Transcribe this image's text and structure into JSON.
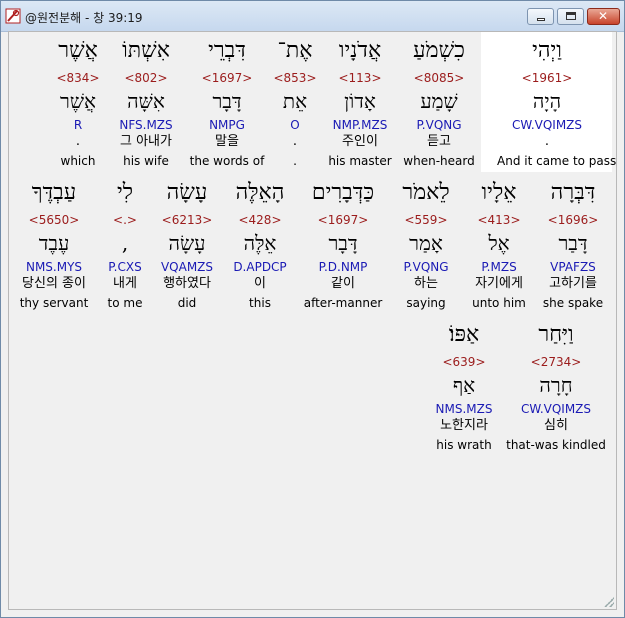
{
  "window": {
    "title": "@원전분해 - 창 39:19"
  },
  "rows": [
    [
      {
        "hebrew": "וַיְהִי",
        "strong": "<1961>",
        "lemma": "הָיָה",
        "morph": "CW.VQIMZS",
        "korean": ".",
        "english": "And it came to pass"
      },
      {
        "hebrew": "כִשְׁמֹעַ",
        "strong": "<8085>",
        "lemma": "שָׁמַע",
        "morph": "P.VQNG",
        "korean": "듣고",
        "english": "when-heard"
      },
      {
        "hebrew": "אֲדֹנָיו",
        "strong": "<113>",
        "lemma": "אָדוֹן",
        "morph": "NMP.MZS",
        "korean": "주인이",
        "english": "his master"
      },
      {
        "hebrew": "אֶת־",
        "strong": "<853>",
        "lemma": "אֵת",
        "morph": "O",
        "korean": ".",
        "english": "."
      },
      {
        "hebrew": "דִּבְרֵי",
        "strong": "<1697>",
        "lemma": "דָּבָר",
        "morph": "NMPG",
        "korean": "말을",
        "english": "the words of"
      },
      {
        "hebrew": "אִשְׁתּוֹ",
        "strong": "<802>",
        "lemma": "אִשָּׁה",
        "morph": "NFS.MZS",
        "korean": "그 아내가",
        "english": "his wife"
      },
      {
        "hebrew": "אֲשֶׁר",
        "strong": "<834>",
        "lemma": "אֲשֶׁר",
        "morph": "R",
        "korean": ".",
        "english": "which"
      }
    ],
    [
      {
        "hebrew": "דִּבְּרָה",
        "strong": "<1696>",
        "lemma": "דָּבַר",
        "morph": "VPAFZS",
        "korean": "고하기를",
        "english": "she spake"
      },
      {
        "hebrew": "אֵלָיו",
        "strong": "<413>",
        "lemma": "אֶל",
        "morph": "P.MZS",
        "korean": "자기에게",
        "english": "unto him"
      },
      {
        "hebrew": "לֵאמֹר",
        "strong": "<559>",
        "lemma": "אָמַר",
        "morph": "P.VQNG",
        "korean": "하는",
        "english": "saying"
      },
      {
        "hebrew": "כַּדְּבָרִים",
        "strong": "<1697>",
        "lemma": "דָּבָר",
        "morph": "P.D.NMP",
        "korean": "같이",
        "english": "after-manner"
      },
      {
        "hebrew": "הָאֵלֶּה",
        "strong": "<428>",
        "lemma": "אֵלֶּה",
        "morph": "D.APDCP",
        "korean": "이",
        "english": "this"
      },
      {
        "hebrew": "עָשָׂה",
        "strong": "<6213>",
        "lemma": "עָשָׂה",
        "morph": "VQAMZS",
        "korean": "행하였다",
        "english": "did"
      },
      {
        "hebrew": "לִי",
        "strong": "<.>",
        "lemma": ",",
        "morph": "P.CXS",
        "korean": "내게",
        "english": "to me"
      },
      {
        "hebrew": "עַבְדֶּךָ",
        "strong": "<5650>",
        "lemma": "עֶבֶד",
        "morph": "NMS.MYS",
        "korean": "당신의 종이",
        "english": "thy servant"
      }
    ],
    [
      {
        "hebrew": "וַיִּחַר",
        "strong": "<2734>",
        "lemma": "חָרָה",
        "morph": "CW.VQIMZS",
        "korean": "심히",
        "english": "that-was kindled"
      },
      {
        "hebrew": "אַפּוֹ׃",
        "strong": "<639>",
        "lemma": "אַף",
        "morph": "NMS.MZS",
        "korean": "노한지라",
        "english": "his wrath"
      }
    ]
  ]
}
